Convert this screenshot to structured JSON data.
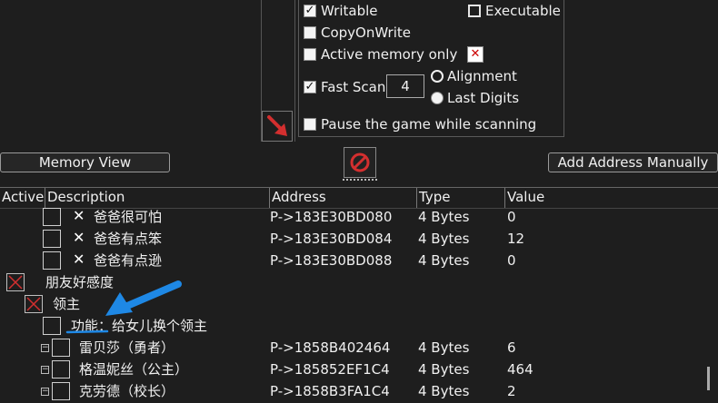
{
  "scan_options": {
    "writable": {
      "label": "Writable",
      "checked": true
    },
    "executable": {
      "label": "Executable",
      "checked": false
    },
    "copy_on_write": {
      "label": "CopyOnWrite",
      "checked": false
    },
    "active_memory_only": {
      "label": "Active memory only",
      "checked": false
    },
    "fast_scan": {
      "label": "Fast Scan",
      "checked": true,
      "value": "4"
    },
    "alignment": {
      "label": "Alignment",
      "selected": true
    },
    "last_digits": {
      "label": "Last Digits",
      "selected": false
    },
    "pause_game": {
      "label": "Pause the game while scanning",
      "checked": false
    }
  },
  "buttons": {
    "memory_view": "Memory View",
    "add_address": "Add Address Manually"
  },
  "table": {
    "headers": {
      "active": "Active",
      "description": "Description",
      "address": "Address",
      "type": "Type",
      "value": "Value"
    },
    "rows": [
      {
        "description": "爸爸很可怕",
        "address": "P->183E30BD080",
        "type": "4 Bytes",
        "value": "0"
      },
      {
        "description": "爸爸有点笨",
        "address": "P->183E30BD084",
        "type": "4 Bytes",
        "value": "12"
      },
      {
        "description": "爸爸有点逊",
        "address": "P->183E30BD088",
        "type": "4 Bytes",
        "value": "0"
      },
      {
        "description": "朋友好感度"
      },
      {
        "description": "领主"
      },
      {
        "description": "功能：给女儿换个领主"
      },
      {
        "description": "雷贝莎（勇者）",
        "address": "P->1858B402464",
        "type": "4 Bytes",
        "value": "6"
      },
      {
        "description": "格温妮丝（公主）",
        "address": "P->185852EF1C4",
        "type": "4 Bytes",
        "value": "464"
      },
      {
        "description": "克劳德（校长）",
        "address": "P->1858B3FA1C4",
        "type": "4 Bytes",
        "value": "2"
      }
    ]
  },
  "colors": {
    "accent_blue": "#1e88e5",
    "red": "#d32f2f"
  }
}
